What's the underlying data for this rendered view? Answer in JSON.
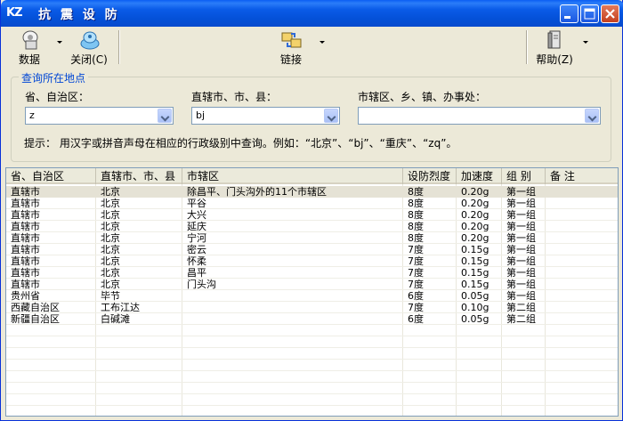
{
  "app": {
    "logo": "KZ",
    "title": "抗 震 设 防"
  },
  "toolbar": {
    "data_label": "数据",
    "close_label": "关闭(C)",
    "link_label": "链接",
    "help_label": "帮助(Z)"
  },
  "query": {
    "group_title": "查询所在地点",
    "province_label": "省、自治区：",
    "province_value": "z",
    "city_label": "直辖市、市、县：",
    "city_value": "bj",
    "district_label": "市辖区、乡、镇、办事处：",
    "district_value": "",
    "hint": "提示： 用汉字或拼音声母在相应的行政级别中查询。例如：“北京”、“bj”、“重庆”、“zq”。"
  },
  "table": {
    "columns": [
      "省、自治区",
      "直辖市、市、县",
      "市辖区",
      "设防烈度",
      "加速度",
      "组  别",
      "备  注"
    ],
    "rows": [
      [
        "直辖市",
        "北京",
        "除昌平、门头沟外的11个市辖区",
        "8度",
        "0.20g",
        "第一组",
        ""
      ],
      [
        "直辖市",
        "北京",
        "平谷",
        "8度",
        "0.20g",
        "第一组",
        ""
      ],
      [
        "直辖市",
        "北京",
        "大兴",
        "8度",
        "0.20g",
        "第一组",
        ""
      ],
      [
        "直辖市",
        "北京",
        "延庆",
        "8度",
        "0.20g",
        "第一组",
        ""
      ],
      [
        "直辖市",
        "北京",
        "宁河",
        "8度",
        "0.20g",
        "第一组",
        ""
      ],
      [
        "直辖市",
        "北京",
        "密云",
        "7度",
        "0.15g",
        "第一组",
        ""
      ],
      [
        "直辖市",
        "北京",
        "怀柔",
        "7度",
        "0.15g",
        "第一组",
        ""
      ],
      [
        "直辖市",
        "北京",
        "昌平",
        "7度",
        "0.15g",
        "第一组",
        ""
      ],
      [
        "直辖市",
        "北京",
        "门头沟",
        "7度",
        "0.15g",
        "第一组",
        ""
      ],
      [
        "贵州省",
        "毕节",
        "",
        "6度",
        "0.05g",
        "第一组",
        ""
      ],
      [
        "西藏自治区",
        "工布江达",
        "",
        "7度",
        "0.10g",
        "第二组",
        ""
      ],
      [
        "新疆自治区",
        "白碱滩",
        "",
        "6度",
        "0.05g",
        "第二组",
        ""
      ]
    ]
  },
  "colors": {
    "titlebar": "#0a5be8",
    "accent": "#0046d5",
    "selected_row": "#e5e2d5"
  }
}
